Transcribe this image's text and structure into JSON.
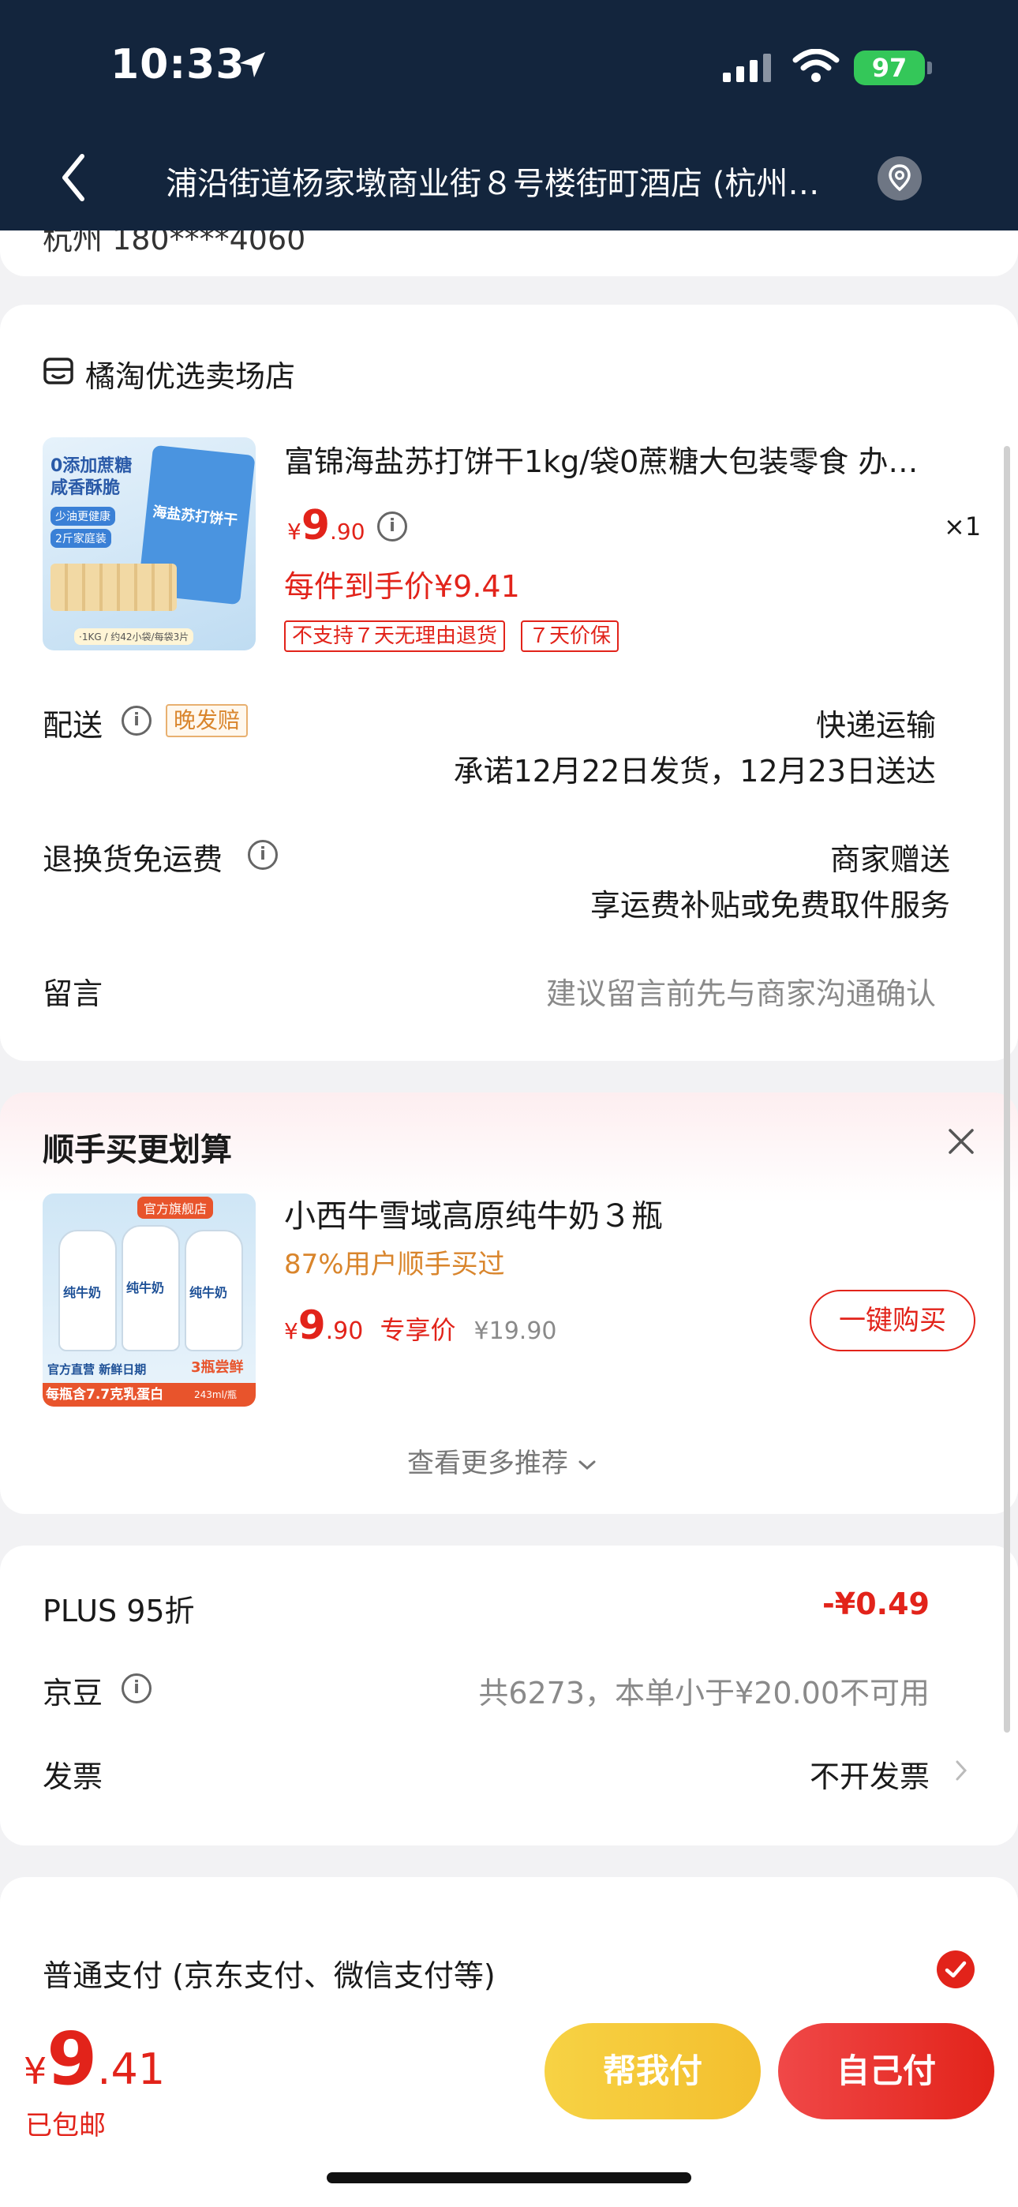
{
  "status": {
    "time": "10:33",
    "battery": "97"
  },
  "header": {
    "address": "浦沿街道杨家墩商业街８号楼街町酒店 (杭州…"
  },
  "partial": {
    "text": "杭州 180****4060"
  },
  "store": {
    "name": "橘淘优选卖场店",
    "product": {
      "title": "富锦海盐苏打饼干1kg/袋0蔗糖大包装零食 办…",
      "price_symbol": "¥",
      "price_int": "9",
      "price_dec": ".90",
      "quantity": "×1",
      "final_price": "每件到手价¥9.41",
      "tags": [
        "不支持７天无理由退货",
        "７天价保"
      ],
      "image_text": {
        "line1": "0添加蔗糖",
        "line2": "咸香酥脆",
        "badge1": "少油更健康",
        "badge2": "2斤家庭装",
        "pack": "海盐苏打饼干",
        "footer": "·1KG / 约42小袋/每袋3片"
      }
    },
    "delivery": {
      "label": "配送",
      "badge": "晚发赔",
      "method": "快递运输",
      "promise": "承诺12月22日发货，12月23日送达"
    },
    "returns": {
      "label": "退换货免运费",
      "value": "商家赠送",
      "sub": "享运费补贴或免费取件服务"
    },
    "message": {
      "label": "留言",
      "placeholder": "建议留言前先与商家沟通确认"
    }
  },
  "recommend": {
    "title": "顺手买更划算",
    "item": {
      "name": "小西牛雪域高原纯牛奶３瓶",
      "percent": "87%用户顺手买过",
      "price_symbol": "¥",
      "price_int": "9",
      "price_dec": ".90",
      "exclusive": "专享价",
      "original": "¥19.90",
      "buy_button": "一键购买",
      "image_text": {
        "flagship": "官方旗舰店",
        "label": "纯牛奶",
        "bottom1": "官方直营 新鲜日期",
        "bottom2": "每瓶含7.7克乳蛋白",
        "bottom3": "3瓶尝鲜",
        "bottom4": "243ml/瓶"
      }
    },
    "more": "查看更多推荐"
  },
  "summary": {
    "plus_label": "PLUS 95折",
    "plus_value": "-¥0.49",
    "jingdou_label": "京豆",
    "jingdou_value": "共6273，本单小于¥20.00不可用",
    "invoice_label": "发票",
    "invoice_value": "不开发票"
  },
  "payment": {
    "label": "普通支付 (京东支付、微信支付等)"
  },
  "bottom": {
    "price_symbol": "¥",
    "price_int": "9",
    "price_dec": ".41",
    "shipping": "已包邮",
    "help_pay": "帮我付",
    "self_pay": "自己付"
  },
  "colors": {
    "header_bg": "#13253d",
    "accent_red": "#e2231a",
    "help_yellow": "#f5c83a",
    "orange": "#d9852c"
  }
}
